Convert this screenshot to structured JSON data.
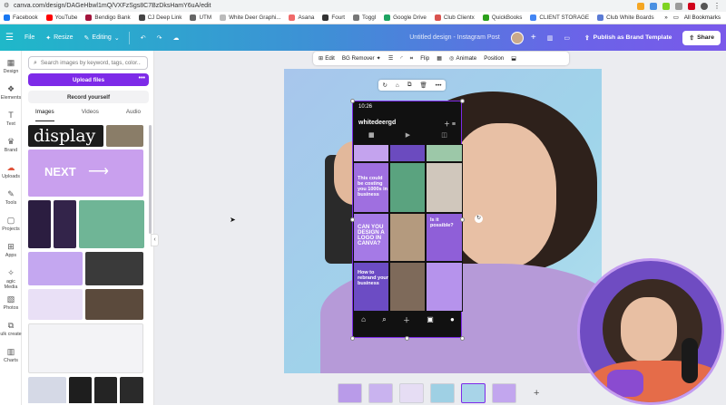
{
  "browser": {
    "url": "canva.com/design/DAGeHbwl1mQ/VXFzSgs8C7BzDksHamY6uA/edit",
    "bookmarks": [
      {
        "label": "Facebook",
        "color": "#1877f2"
      },
      {
        "label": "YouTube",
        "color": "#ff0000"
      },
      {
        "label": "Bendigo Bank",
        "color": "#a3143c"
      },
      {
        "label": "CJ Deep Link",
        "color": "#444444"
      },
      {
        "label": "UTM",
        "color": "#666666"
      },
      {
        "label": "White Deer Graphi...",
        "color": "#bbbbbb"
      },
      {
        "label": "Asana",
        "color": "#f06a6a"
      },
      {
        "label": "Fourt",
        "color": "#333333"
      },
      {
        "label": "Toggl",
        "color": "#777777"
      },
      {
        "label": "Google Drive",
        "color": "#1fa463"
      },
      {
        "label": "Club Clientx",
        "color": "#d9534f"
      },
      {
        "label": "QuickBooks",
        "color": "#2ca01c"
      },
      {
        "label": "CLIENT STORAGE",
        "color": "#4285f4"
      },
      {
        "label": "Club White Boards",
        "color": "#5b7bd5"
      }
    ],
    "all_bookmarks": "All Bookmarks"
  },
  "toolbar": {
    "file": "File",
    "resize": "Resize",
    "editing": "Editing",
    "design_title": "Untitled design - Instagram Post",
    "publish": "Publish as Brand Template",
    "share": "Share"
  },
  "rail": [
    {
      "label": "Design",
      "icon": "design-icon"
    },
    {
      "label": "Elements",
      "icon": "elements-icon"
    },
    {
      "label": "Text",
      "icon": "text-icon"
    },
    {
      "label": "Brand",
      "icon": "brand-icon"
    },
    {
      "label": "Uploads",
      "icon": "uploads-icon"
    },
    {
      "label": "Tools",
      "icon": "tools-icon"
    },
    {
      "label": "Projects",
      "icon": "projects-icon"
    },
    {
      "label": "Apps",
      "icon": "apps-icon"
    },
    {
      "label": "agic Media",
      "icon": "magic-media-icon"
    },
    {
      "label": "Photos",
      "icon": "photos-icon"
    },
    {
      "label": "ulk create",
      "icon": "bulk-create-icon"
    },
    {
      "label": "Charts",
      "icon": "charts-icon"
    }
  ],
  "panel": {
    "search_placeholder": "Search images by keyword, tags, color...",
    "upload": "Upload files",
    "record": "Record yourself",
    "tabs": [
      "Images",
      "Videos",
      "Audio"
    ],
    "active_tab": "Images",
    "thumb_display": "display",
    "thumb_next": "NEXT"
  },
  "context_toolbar": {
    "edit": "Edit",
    "bg_remover": "BG Remover",
    "flip": "Flip",
    "animate": "Animate",
    "position": "Position"
  },
  "phone": {
    "time": "10:26",
    "username": "whitedeergd",
    "posts": [
      "This could be costing you 1000s in business",
      "Is it possible?",
      "CAN YOU DESIGN A LOGO IN CANVA?",
      "How to rebrand your business"
    ]
  },
  "colors": {
    "accent": "#7d2ae8",
    "topbar_start": "#1fb8c9",
    "topbar_end": "#7a59ea"
  }
}
